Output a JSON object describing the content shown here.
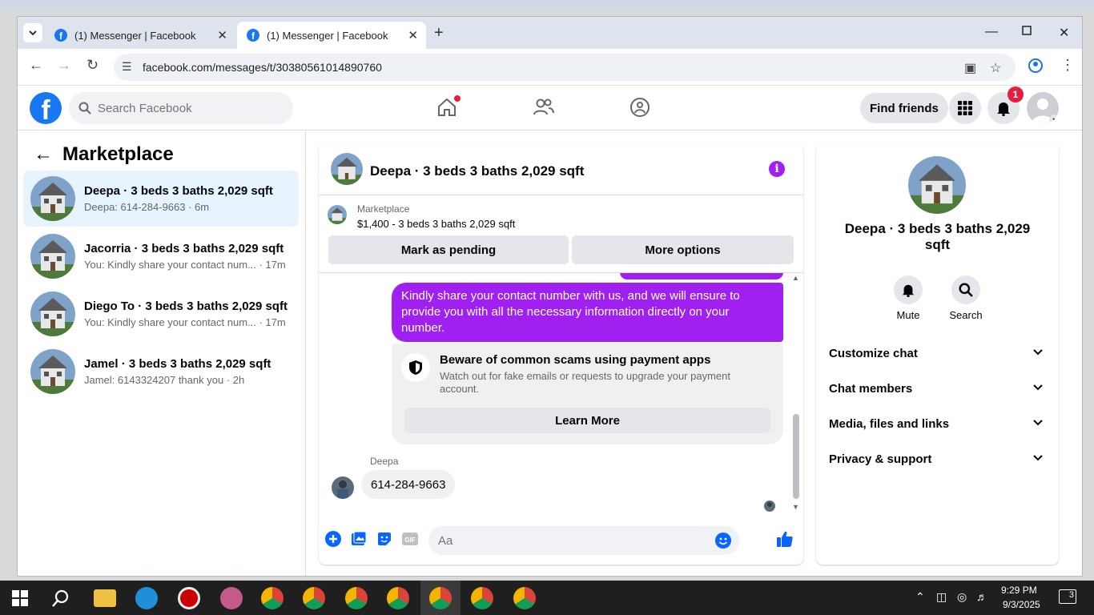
{
  "browser": {
    "tabs": [
      {
        "title": "(1) Messenger | Facebook"
      },
      {
        "title": "(1) Messenger | Facebook"
      }
    ],
    "url": "facebook.com/messages/t/30380561014890760"
  },
  "fb_header": {
    "search_placeholder": "Search Facebook",
    "find_friends": "Find friends",
    "notification_count": "1"
  },
  "left_panel": {
    "title": "Marketplace",
    "conversations": [
      {
        "title": "Deepa · 3 beds 3 baths 2,029 sqft",
        "preview": "Deepa: 614-284-9663 · 6m",
        "selected": true
      },
      {
        "title": "Jacorria · 3 beds 3 baths 2,029 sqft",
        "preview": "You: Kindly share your contact num... · 17m"
      },
      {
        "title": "Diego To · 3 beds 3 baths 2,029 sqft",
        "preview": "You: Kindly share your contact num... · 17m"
      },
      {
        "title": "Jamel · 3 beds 3 baths 2,029 sqft",
        "preview": "Jamel: 6143324207 thank you · 2h"
      }
    ]
  },
  "chat": {
    "header_title": "Deepa · 3 beds 3 baths 2,029 sqft",
    "marketplace_label": "Marketplace",
    "listing": "$1,400 - 3 beds 3 baths 2,029 sqft",
    "mark_pending": "Mark as pending",
    "more_options": "More options",
    "outgoing_message": "Kindly share your contact number with us, and we will ensure to provide you with all the necessary information directly on your number.",
    "scam_title": "Beware of common scams using payment apps",
    "scam_desc": "Watch out for fake emails or requests to upgrade your payment account.",
    "learn_more": "Learn More",
    "sender_name": "Deepa",
    "incoming_message": "614-284-9663",
    "composer_placeholder": "Aa"
  },
  "right_panel": {
    "name": "Deepa · 3 beds 3 baths 2,029 sqft",
    "mute": "Mute",
    "search": "Search",
    "sections": [
      "Customize chat",
      "Chat members",
      "Media, files and links",
      "Privacy & support"
    ]
  },
  "taskbar": {
    "time": "9:29 PM",
    "date": "9/3/2025",
    "notification_count": "3"
  },
  "colors": {
    "fb_blue": "#1877f2",
    "messenger_purple": "#a020f0",
    "selected_bg": "#e7f3ff"
  }
}
